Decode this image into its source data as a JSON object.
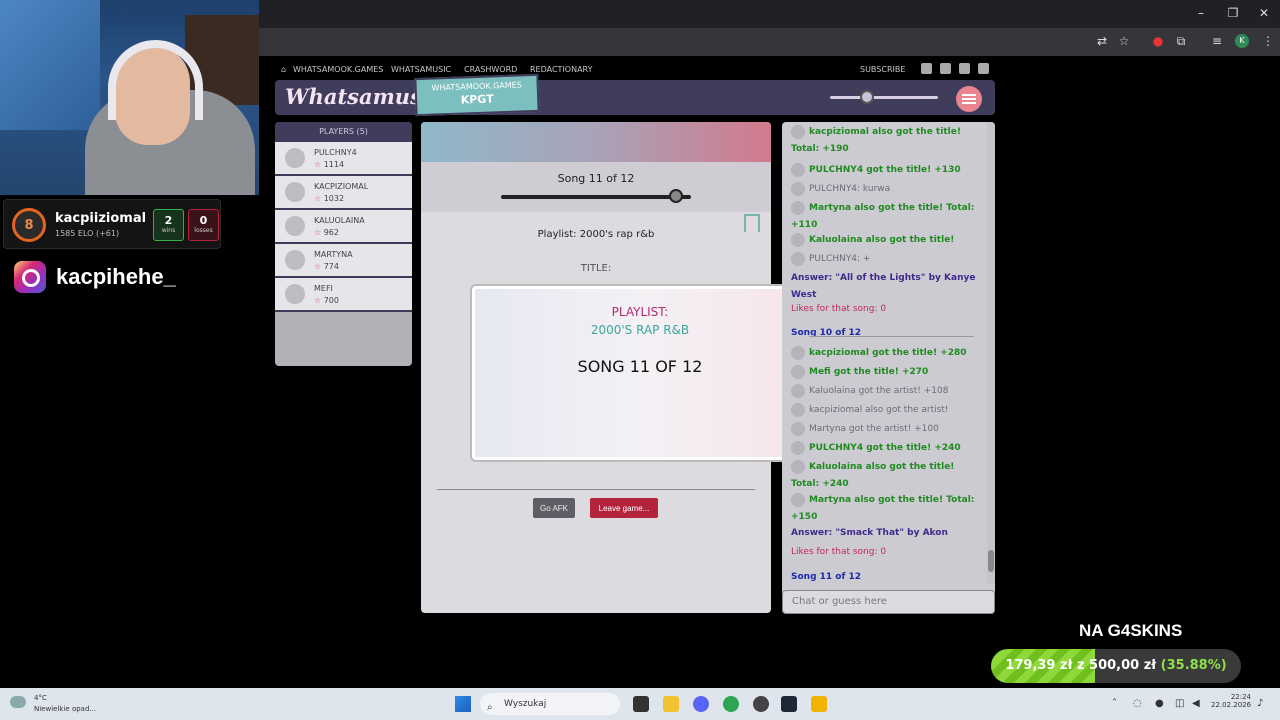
{
  "streamer": {
    "name": "kacpiiziomal",
    "elo": "1585 ELO (+61)",
    "level": "8",
    "wins": "2",
    "wins_label": "wins",
    "losses": "0",
    "losses_label": "losses",
    "instagram": "kacpihehe_"
  },
  "site_nav": {
    "home": "WHATSAMOOK.GAMES",
    "whatsamusic": "WHATSAMUSIC",
    "crashword": "CRASHWORD",
    "redactionary": "REDACTIONARY",
    "subscribe": "SUBSCRIBE"
  },
  "header": {
    "logo": "Whatsamusic",
    "tag_top": "WHATSAMOOK.GAMES",
    "tag_bottom": "KPGT"
  },
  "players": {
    "header": "PLAYERS (5)",
    "list": [
      {
        "name": "PULCHNY4",
        "score": "1114"
      },
      {
        "name": "KACPIZIOMAL",
        "score": "1032"
      },
      {
        "name": "KALUOLAINA",
        "score": "962"
      },
      {
        "name": "MARTYNA",
        "score": "774"
      },
      {
        "name": "MEFI",
        "score": "700"
      }
    ]
  },
  "game": {
    "song_count": "Song 11 of 12",
    "song_progress": 0.92,
    "playlist_line": "Playlist: 2000's rap r&b",
    "title_label": "TITLE:",
    "afk_button": "Go AFK",
    "leave_button": "Leave game..."
  },
  "modal": {
    "playlist_label": "PLAYLIST:",
    "playlist_name": "2000'S RAP R&B",
    "song_label": "SONG 11 OF 12"
  },
  "chat": {
    "messages": [
      {
        "text": "kacpiziomal also got the title! Total: +190",
        "kind": "g"
      },
      {
        "text": "PULCHNY4 got the title! +130",
        "kind": "g"
      },
      {
        "text": "PULCHNY4: kurwa",
        "kind": "gr"
      },
      {
        "text": "Martyna also got the title! Total: +110",
        "kind": "g"
      },
      {
        "text": "Kaluolaina also got the title!",
        "kind": "g"
      },
      {
        "text": "PULCHNY4: +",
        "kind": "gr"
      },
      {
        "text": "Answer: \"All of the Lights\" by Kanye West",
        "kind": "ans"
      },
      {
        "text": "Likes for that song: 0",
        "kind": "lk"
      },
      {
        "text": "Song 10 of 12",
        "kind": "sg"
      },
      {
        "text": "kacpiziomal got the title! +280",
        "kind": "g"
      },
      {
        "text": "Mefi got the title! +270",
        "kind": "g"
      },
      {
        "text": "Kaluolaina got the artist! +108",
        "kind": "gr"
      },
      {
        "text": "kacpiziomal also got the artist!",
        "kind": "gr"
      },
      {
        "text": "Martyna got the artist! +100",
        "kind": "gr"
      },
      {
        "text": "PULCHNY4 got the title! +240",
        "kind": "g"
      },
      {
        "text": "Kaluolaina also got the title! Total: +240",
        "kind": "g"
      },
      {
        "text": "Martyna also got the title! Total: +150",
        "kind": "g"
      },
      {
        "text": "Answer: \"Smack That\" by Akon",
        "kind": "ans"
      },
      {
        "text": "Likes for that song: 0",
        "kind": "lk"
      },
      {
        "text": "Song 11 of 12",
        "kind": "sg"
      }
    ],
    "input_placeholder": "Chat or guess here"
  },
  "donation": {
    "title": "NA G4SKINS",
    "current": "179,39 zł",
    "goal_text": "z 500,00 zł",
    "percent_text": "(35.88%)",
    "fraction": 0.3588
  },
  "taskbar": {
    "weather_temp": "4°C",
    "weather_desc": "Niewielkie opad...",
    "search_placeholder": "Wyszukaj",
    "time": "22:24",
    "date": "22.02.2026"
  }
}
